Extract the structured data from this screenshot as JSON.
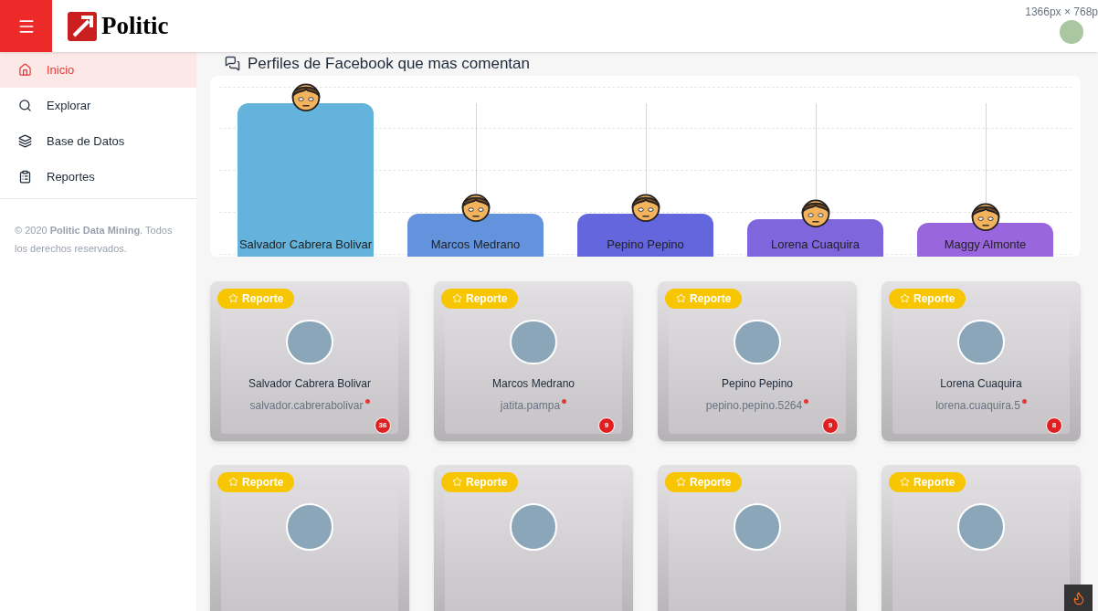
{
  "header": {
    "brand": "Politic",
    "resolution_overlay": "1366px × 768p"
  },
  "sidebar": {
    "items": [
      {
        "label": "Inicio",
        "selected": true
      },
      {
        "label": "Explorar",
        "selected": false
      },
      {
        "label": "Base de Datos",
        "selected": false
      },
      {
        "label": "Reportes",
        "selected": false
      }
    ],
    "footer": "© 2020 **Politic Data Mining**. Todos los derechos reservados."
  },
  "section_title": "Perfiles de Facebook que mas comentan",
  "bars": [
    {
      "name": "Salvador Cabrera Bolivar",
      "color": "#63b3dc"
    },
    {
      "name": "Marcos Medrano",
      "color": "#6493dd"
    },
    {
      "name": "Pepino Pepino",
      "color": "#6366dc"
    },
    {
      "name": "Lorena Cuaquira",
      "color": "#7f66dd"
    },
    {
      "name": "Maggy Almonte",
      "color": "#9a66dd"
    }
  ],
  "cards": [
    {
      "badge": "Reporte",
      "name": "Salvador Cabrera Bolivar",
      "username": "salvador.cabrerabolivar",
      "count": "36"
    },
    {
      "badge": "Reporte",
      "name": "Marcos Medrano",
      "username": "jatita.pampa",
      "count": "9"
    },
    {
      "badge": "Reporte",
      "name": "Pepino Pepino",
      "username": "pepino.pepino.5264",
      "count": "9"
    },
    {
      "badge": "Reporte",
      "name": "Lorena Cuaquira",
      "username": "lorena.cuaquira.5",
      "count": "8"
    },
    {
      "badge": "Reporte"
    },
    {
      "badge": "Reporte"
    },
    {
      "badge": "Reporte"
    },
    {
      "badge": "Reporte"
    }
  ]
}
